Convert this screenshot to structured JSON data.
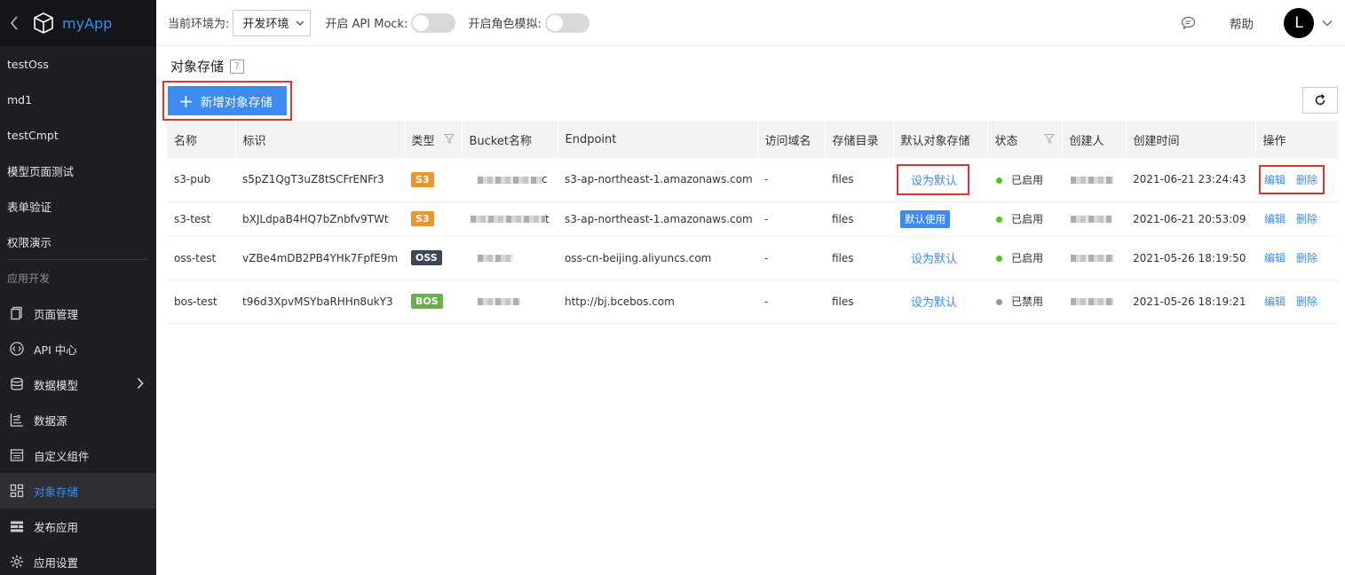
{
  "app": {
    "name": "myApp"
  },
  "sidebar": {
    "items": [
      {
        "label": "testOss"
      },
      {
        "label": "md1"
      },
      {
        "label": "testCmpt"
      },
      {
        "label": "模型页面测试"
      },
      {
        "label": "表单验证"
      },
      {
        "label": "权限演示"
      }
    ],
    "group_label": "应用开发",
    "dev_items": [
      {
        "label": "页面管理",
        "icon": "page-icon"
      },
      {
        "label": "API 中心",
        "icon": "code-icon"
      },
      {
        "label": "数据模型",
        "icon": "database-icon"
      },
      {
        "label": "数据源",
        "icon": "datasource-icon"
      },
      {
        "label": "自定义组件",
        "icon": "component-icon"
      },
      {
        "label": "对象存储",
        "icon": "grid-icon",
        "active": true
      },
      {
        "label": "发布应用",
        "icon": "publish-icon"
      },
      {
        "label": "应用设置",
        "icon": "gear-icon"
      }
    ]
  },
  "topbar": {
    "env_label": "当前环境为:",
    "env_value": "开发环境",
    "api_mock_label": "开启 API Mock:",
    "role_label": "开启角色模拟:",
    "help_label": "帮助",
    "avatar_letter": "L"
  },
  "page": {
    "title": "对象存储",
    "help_icon": "?",
    "add_button": "新增对象存储"
  },
  "table": {
    "columns": [
      "名称",
      "标识",
      "类型",
      "Bucket名称",
      "Endpoint",
      "访问域名",
      "存储目录",
      "默认对象存储",
      "状态",
      "创建人",
      "创建时间",
      "操作"
    ],
    "rows": [
      {
        "name": "s3-pub",
        "id": "s5pZ1QgT3uZ8tSCFrENFr3",
        "type": "S3",
        "type_color": "#e8962e",
        "bucket_suffix": "c",
        "endpoint": "s3-ap-northeast-1.amazonaws.com",
        "domain": "-",
        "dir": "files",
        "default_action": "设为默认",
        "status": "已启用",
        "status_color": "#52c41a",
        "created": "2021-06-21 23:24:43",
        "edit": "编辑",
        "delete": "删除"
      },
      {
        "name": "s3-test",
        "id": "bXJLdpaB4HQ7bZnbfv9TWt",
        "type": "S3",
        "type_color": "#e8962e",
        "bucket_suffix": "t",
        "endpoint": "s3-ap-northeast-1.amazonaws.com",
        "domain": "-",
        "dir": "files",
        "default_badge": "默认使用",
        "status": "已启用",
        "status_color": "#52c41a",
        "created": "2021-06-21 20:53:09",
        "edit": "编辑",
        "delete": "删除"
      },
      {
        "name": "oss-test",
        "id": "vZBe4mDB2PB4YHk7FpfE9m",
        "type": "OSS",
        "type_color": "#3c4656",
        "bucket_suffix": "",
        "endpoint": "oss-cn-beijing.aliyuncs.com",
        "domain": "-",
        "dir": "files",
        "default_action": "设为默认",
        "status": "已启用",
        "status_color": "#52c41a",
        "created": "2021-05-26 18:19:50",
        "edit": "编辑",
        "delete": "删除"
      },
      {
        "name": "bos-test",
        "id": "t96d3XpvMSYbaRHHn8ukY3",
        "type": "BOS",
        "type_color": "#6ab04c",
        "bucket_suffix": "",
        "endpoint": "http://bj.bcebos.com",
        "domain": "-",
        "dir": "files",
        "default_action": "设为默认",
        "status": "已禁用",
        "status_color": "#999999",
        "created": "2021-05-26 18:19:21",
        "edit": "编辑",
        "delete": "删除"
      }
    ]
  }
}
